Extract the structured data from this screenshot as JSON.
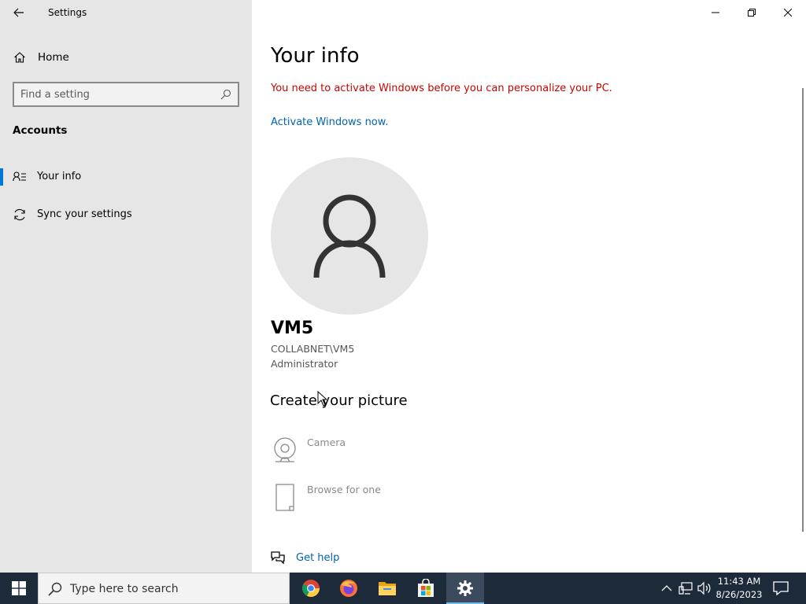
{
  "window": {
    "title": "Settings",
    "minimize_icon": "minimize-icon",
    "maximize_icon": "restore-icon",
    "close_icon": "close-icon"
  },
  "sidebar": {
    "home_label": "Home",
    "search_placeholder": "Find a setting",
    "section_title": "Accounts",
    "items": [
      {
        "label": "Your info",
        "icon": "person-list-icon",
        "active": true
      },
      {
        "label": "Sync your settings",
        "icon": "sync-icon",
        "active": false
      }
    ]
  },
  "main": {
    "title": "Your info",
    "warning": "You need to activate Windows before you can personalize your PC.",
    "activate_link": "Activate Windows now.",
    "user": {
      "name": "VM5",
      "domain": "COLLABNET\\VM5",
      "role": "Administrator"
    },
    "create_title": "Create your picture",
    "picture_options": [
      {
        "label": "Camera",
        "icon": "camera-icon"
      },
      {
        "label": "Browse for one",
        "icon": "file-icon"
      }
    ],
    "help_label": "Get help"
  },
  "taskbar": {
    "search_placeholder": "Type here to search",
    "apps": [
      "chrome",
      "firefox",
      "file-explorer",
      "microsoft-store",
      "settings"
    ],
    "active_app": "settings",
    "time": "11:43 AM",
    "date": "8/26/2023"
  },
  "colors": {
    "warning": "#c50500",
    "link": "#0063b1",
    "accent": "#0078d7",
    "taskbar": "#1c2a3a"
  }
}
